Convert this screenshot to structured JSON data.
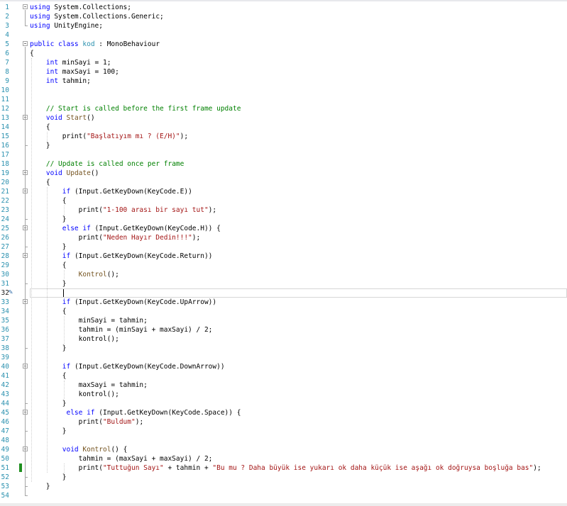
{
  "editor": {
    "language": "C#",
    "current_line": 32,
    "lines": [
      {
        "n": "1",
        "fold": "open",
        "tokens": [
          {
            "t": "using ",
            "c": "kw"
          },
          {
            "t": "System.Collections;",
            "c": ""
          }
        ]
      },
      {
        "n": "2",
        "tokens": [
          {
            "t": "using ",
            "c": "kw"
          },
          {
            "t": "System.Collections.Generic;",
            "c": ""
          }
        ]
      },
      {
        "n": "3",
        "tokens": [
          {
            "t": "using ",
            "c": "kw"
          },
          {
            "t": "UnityEngine;",
            "c": ""
          }
        ]
      },
      {
        "n": "4",
        "tokens": []
      },
      {
        "n": "5",
        "fold": "open",
        "tokens": [
          {
            "t": "public ",
            "c": "kw"
          },
          {
            "t": "class ",
            "c": "kw"
          },
          {
            "t": "kod",
            "c": "type"
          },
          {
            "t": " : MonoBehaviour",
            "c": ""
          }
        ]
      },
      {
        "n": "6",
        "tokens": [
          {
            "t": "{",
            "c": ""
          }
        ]
      },
      {
        "n": "7",
        "tokens": [
          {
            "t": "    ",
            "c": ""
          },
          {
            "t": "int",
            "c": "kw"
          },
          {
            "t": " minSayi = 1;",
            "c": ""
          }
        ]
      },
      {
        "n": "8",
        "tokens": [
          {
            "t": "    ",
            "c": ""
          },
          {
            "t": "int",
            "c": "kw"
          },
          {
            "t": " maxSayi = 100;",
            "c": ""
          }
        ]
      },
      {
        "n": "9",
        "tokens": [
          {
            "t": "    ",
            "c": ""
          },
          {
            "t": "int",
            "c": "kw"
          },
          {
            "t": " tahmin;",
            "c": ""
          }
        ]
      },
      {
        "n": "10",
        "tokens": []
      },
      {
        "n": "11",
        "tokens": []
      },
      {
        "n": "12",
        "tokens": [
          {
            "t": "    ",
            "c": ""
          },
          {
            "t": "// Start is called before the first frame update",
            "c": "cm"
          }
        ]
      },
      {
        "n": "13",
        "fold": "open",
        "tokens": [
          {
            "t": "    ",
            "c": ""
          },
          {
            "t": "void",
            "c": "kw"
          },
          {
            "t": " ",
            "c": ""
          },
          {
            "t": "Start",
            "c": "method"
          },
          {
            "t": "()",
            "c": ""
          }
        ]
      },
      {
        "n": "14",
        "tokens": [
          {
            "t": "    {",
            "c": ""
          }
        ]
      },
      {
        "n": "15",
        "tokens": [
          {
            "t": "        print(",
            "c": ""
          },
          {
            "t": "\"Başlatıyım mı ? (E/H)\"",
            "c": "str"
          },
          {
            "t": ");",
            "c": ""
          }
        ]
      },
      {
        "n": "16",
        "tokens": [
          {
            "t": "    }",
            "c": ""
          }
        ]
      },
      {
        "n": "17",
        "tokens": []
      },
      {
        "n": "18",
        "tokens": [
          {
            "t": "    ",
            "c": ""
          },
          {
            "t": "// Update is called once per frame",
            "c": "cm"
          }
        ]
      },
      {
        "n": "19",
        "fold": "open",
        "tokens": [
          {
            "t": "    ",
            "c": ""
          },
          {
            "t": "void",
            "c": "kw"
          },
          {
            "t": " ",
            "c": ""
          },
          {
            "t": "Update",
            "c": "method"
          },
          {
            "t": "()",
            "c": ""
          }
        ]
      },
      {
        "n": "20",
        "tokens": [
          {
            "t": "    {",
            "c": ""
          }
        ]
      },
      {
        "n": "21",
        "fold": "open",
        "tokens": [
          {
            "t": "        ",
            "c": ""
          },
          {
            "t": "if",
            "c": "kw"
          },
          {
            "t": " (Input.GetKeyDown(KeyCode.E))",
            "c": ""
          }
        ]
      },
      {
        "n": "22",
        "tokens": [
          {
            "t": "        {",
            "c": ""
          }
        ]
      },
      {
        "n": "23",
        "tokens": [
          {
            "t": "            print(",
            "c": ""
          },
          {
            "t": "\"1-100 arası bir sayı tut\"",
            "c": "str"
          },
          {
            "t": ");",
            "c": ""
          }
        ]
      },
      {
        "n": "24",
        "tokens": [
          {
            "t": "        }",
            "c": ""
          }
        ]
      },
      {
        "n": "25",
        "fold": "open",
        "tokens": [
          {
            "t": "        ",
            "c": ""
          },
          {
            "t": "else if",
            "c": "kw"
          },
          {
            "t": " (Input.GetKeyDown(KeyCode.H)) {",
            "c": ""
          }
        ]
      },
      {
        "n": "26",
        "tokens": [
          {
            "t": "            print(",
            "c": ""
          },
          {
            "t": "\"Neden Hayır Dedin!!!\"",
            "c": "str"
          },
          {
            "t": ");",
            "c": ""
          }
        ]
      },
      {
        "n": "27",
        "tokens": [
          {
            "t": "        }",
            "c": ""
          }
        ]
      },
      {
        "n": "28",
        "fold": "open",
        "tokens": [
          {
            "t": "        ",
            "c": ""
          },
          {
            "t": "if",
            "c": "kw"
          },
          {
            "t": " (Input.GetKeyDown(KeyCode.Return))",
            "c": ""
          }
        ]
      },
      {
        "n": "29",
        "tokens": [
          {
            "t": "        {",
            "c": ""
          }
        ]
      },
      {
        "n": "30",
        "tokens": [
          {
            "t": "            ",
            "c": ""
          },
          {
            "t": "Kontrol",
            "c": "method"
          },
          {
            "t": "();",
            "c": ""
          }
        ]
      },
      {
        "n": "31",
        "tokens": [
          {
            "t": "        }",
            "c": ""
          }
        ]
      },
      {
        "n": "32",
        "current": true,
        "tokens": [
          {
            "t": "        ",
            "c": ""
          }
        ]
      },
      {
        "n": "33",
        "fold": "open",
        "tokens": [
          {
            "t": "        ",
            "c": ""
          },
          {
            "t": "if",
            "c": "kw"
          },
          {
            "t": " (Input.GetKeyDown(KeyCode.UpArrow))",
            "c": ""
          }
        ]
      },
      {
        "n": "34",
        "tokens": [
          {
            "t": "        {",
            "c": ""
          }
        ]
      },
      {
        "n": "35",
        "tokens": [
          {
            "t": "            minSayi = tahmin;",
            "c": ""
          }
        ]
      },
      {
        "n": "36",
        "tokens": [
          {
            "t": "            tahmin = (minSayi + maxSayi) / 2;",
            "c": ""
          }
        ]
      },
      {
        "n": "37",
        "tokens": [
          {
            "t": "            kontrol();",
            "c": ""
          }
        ]
      },
      {
        "n": "38",
        "tokens": [
          {
            "t": "        }",
            "c": ""
          }
        ]
      },
      {
        "n": "39",
        "tokens": []
      },
      {
        "n": "40",
        "fold": "open",
        "tokens": [
          {
            "t": "        ",
            "c": ""
          },
          {
            "t": "if",
            "c": "kw"
          },
          {
            "t": " (Input.GetKeyDown(KeyCode.DownArrow))",
            "c": ""
          }
        ]
      },
      {
        "n": "41",
        "tokens": [
          {
            "t": "        {",
            "c": ""
          }
        ]
      },
      {
        "n": "42",
        "tokens": [
          {
            "t": "            maxSayi = tahmin;",
            "c": ""
          }
        ]
      },
      {
        "n": "43",
        "tokens": [
          {
            "t": "            kontrol();",
            "c": ""
          }
        ]
      },
      {
        "n": "44",
        "tokens": [
          {
            "t": "        }",
            "c": ""
          }
        ]
      },
      {
        "n": "45",
        "fold": "open",
        "tokens": [
          {
            "t": "         ",
            "c": ""
          },
          {
            "t": "else if",
            "c": "kw"
          },
          {
            "t": " (Input.GetKeyDown(KeyCode.Space)) {",
            "c": ""
          }
        ]
      },
      {
        "n": "46",
        "tokens": [
          {
            "t": "            print(",
            "c": ""
          },
          {
            "t": "\"Buldum\"",
            "c": "str"
          },
          {
            "t": ");",
            "c": ""
          }
        ]
      },
      {
        "n": "47",
        "tokens": [
          {
            "t": "        }",
            "c": ""
          }
        ]
      },
      {
        "n": "48",
        "tokens": []
      },
      {
        "n": "49",
        "fold": "open",
        "tokens": [
          {
            "t": "        ",
            "c": ""
          },
          {
            "t": "void",
            "c": "kw"
          },
          {
            "t": " ",
            "c": ""
          },
          {
            "t": "Kontrol",
            "c": "method"
          },
          {
            "t": "() {",
            "c": ""
          }
        ]
      },
      {
        "n": "50",
        "tokens": [
          {
            "t": "            tahmin = (maxSayi + maxSayi) / 2;",
            "c": ""
          }
        ]
      },
      {
        "n": "51",
        "changed": true,
        "tokens": [
          {
            "t": "            print(",
            "c": ""
          },
          {
            "t": "\"Tuttuğun Sayı\"",
            "c": "str"
          },
          {
            "t": " + tahmin + ",
            "c": ""
          },
          {
            "t": "\"Bu mu ? Daha büyük ise yukarı ok daha küçük ise aşağı ok doğruysa boşluğa bas\"",
            "c": "str"
          },
          {
            "t": ");",
            "c": ""
          }
        ]
      },
      {
        "n": "52",
        "tokens": [
          {
            "t": "        }",
            "c": ""
          }
        ]
      },
      {
        "n": "53",
        "tokens": [
          {
            "t": "    }",
            "c": ""
          }
        ]
      },
      {
        "n": "54",
        "tokens": []
      }
    ]
  },
  "icons": {
    "fold": "collapse-icon",
    "edit": "pencil-icon",
    "change": "change-marker"
  },
  "colors": {
    "keyword": "#0000ff",
    "type": "#2b91af",
    "string": "#a31515",
    "comment": "#008000",
    "method": "#74531f",
    "line_number": "#2b91af"
  }
}
